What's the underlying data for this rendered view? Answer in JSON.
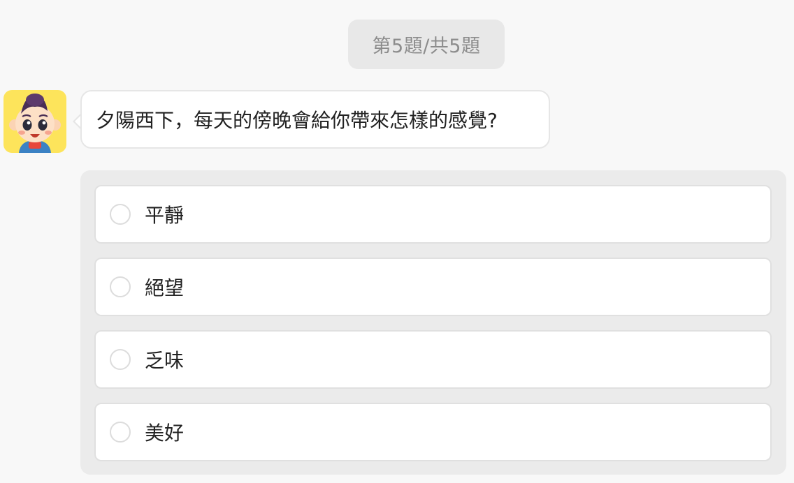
{
  "progress": {
    "label": "第5題/共5題"
  },
  "question": {
    "avatar": "cartoon-boy-avatar",
    "text": "夕陽西下，每天的傍晚會給你帶來怎樣的感覺?"
  },
  "options": [
    {
      "label": "平靜",
      "selected": false
    },
    {
      "label": "絕望",
      "selected": false
    },
    {
      "label": "乏味",
      "selected": false
    },
    {
      "label": "美好",
      "selected": false
    }
  ],
  "colors": {
    "background": "#f8f8f8",
    "badge": "#e8e8e8",
    "avatar_bg": "#fde45b",
    "panel": "#ebebeb",
    "text": "#222222"
  }
}
